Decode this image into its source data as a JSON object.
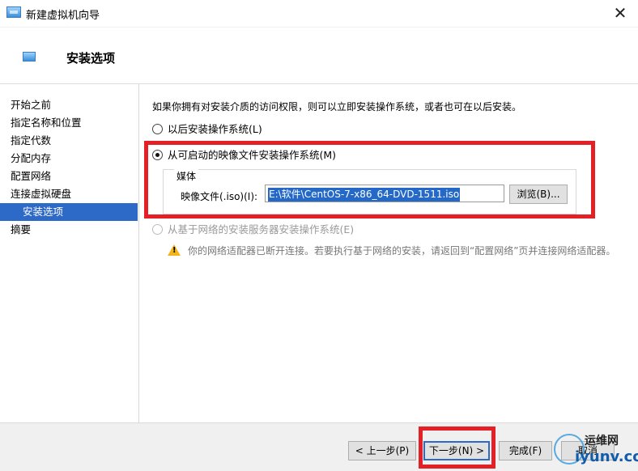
{
  "window": {
    "title": "新建虚拟机向导",
    "close_glyph": "✕"
  },
  "header": {
    "title": "安装选项"
  },
  "sidebar": {
    "items": [
      {
        "label": "开始之前",
        "active": false
      },
      {
        "label": "指定名称和位置",
        "active": false
      },
      {
        "label": "指定代数",
        "active": false
      },
      {
        "label": "分配内存",
        "active": false
      },
      {
        "label": "配置网络",
        "active": false
      },
      {
        "label": "连接虚拟硬盘",
        "active": false
      },
      {
        "label": "安装选项",
        "active": true
      },
      {
        "label": "摘要",
        "active": false
      }
    ]
  },
  "content": {
    "intro": "如果你拥有对安装介质的访问权限，则可以立即安装操作系统，或者也可在以后安装。",
    "options": [
      {
        "label": "以后安装操作系统(L)",
        "checked": false,
        "disabled": false
      },
      {
        "label": "从可启动的映像文件安装操作系统(M)",
        "checked": true,
        "disabled": false
      },
      {
        "label": "从基于网络的安装服务器安装操作系统(E)",
        "checked": false,
        "disabled": true
      }
    ],
    "media": {
      "legend": "媒体",
      "iso_label": "映像文件(.iso)(I):",
      "iso_value": "E:\\软件\\CentOS-7-x86_64-DVD-1511.iso",
      "browse_label": "浏览(B)..."
    },
    "warning": "你的网络适配器已断开连接。若要执行基于网络的安装，请返回到“配置网络”页并连接网络适配器。"
  },
  "footer": {
    "prev_label": "< 上一步(P)",
    "next_label": "下一步(N) >",
    "finish_label": "完成(F)",
    "cancel_label": "取消"
  },
  "watermark": {
    "top": "运维网",
    "bottom": "iyunv.com"
  },
  "colors": {
    "highlight": "#2d69c7",
    "annotation_red": "#e32026"
  }
}
